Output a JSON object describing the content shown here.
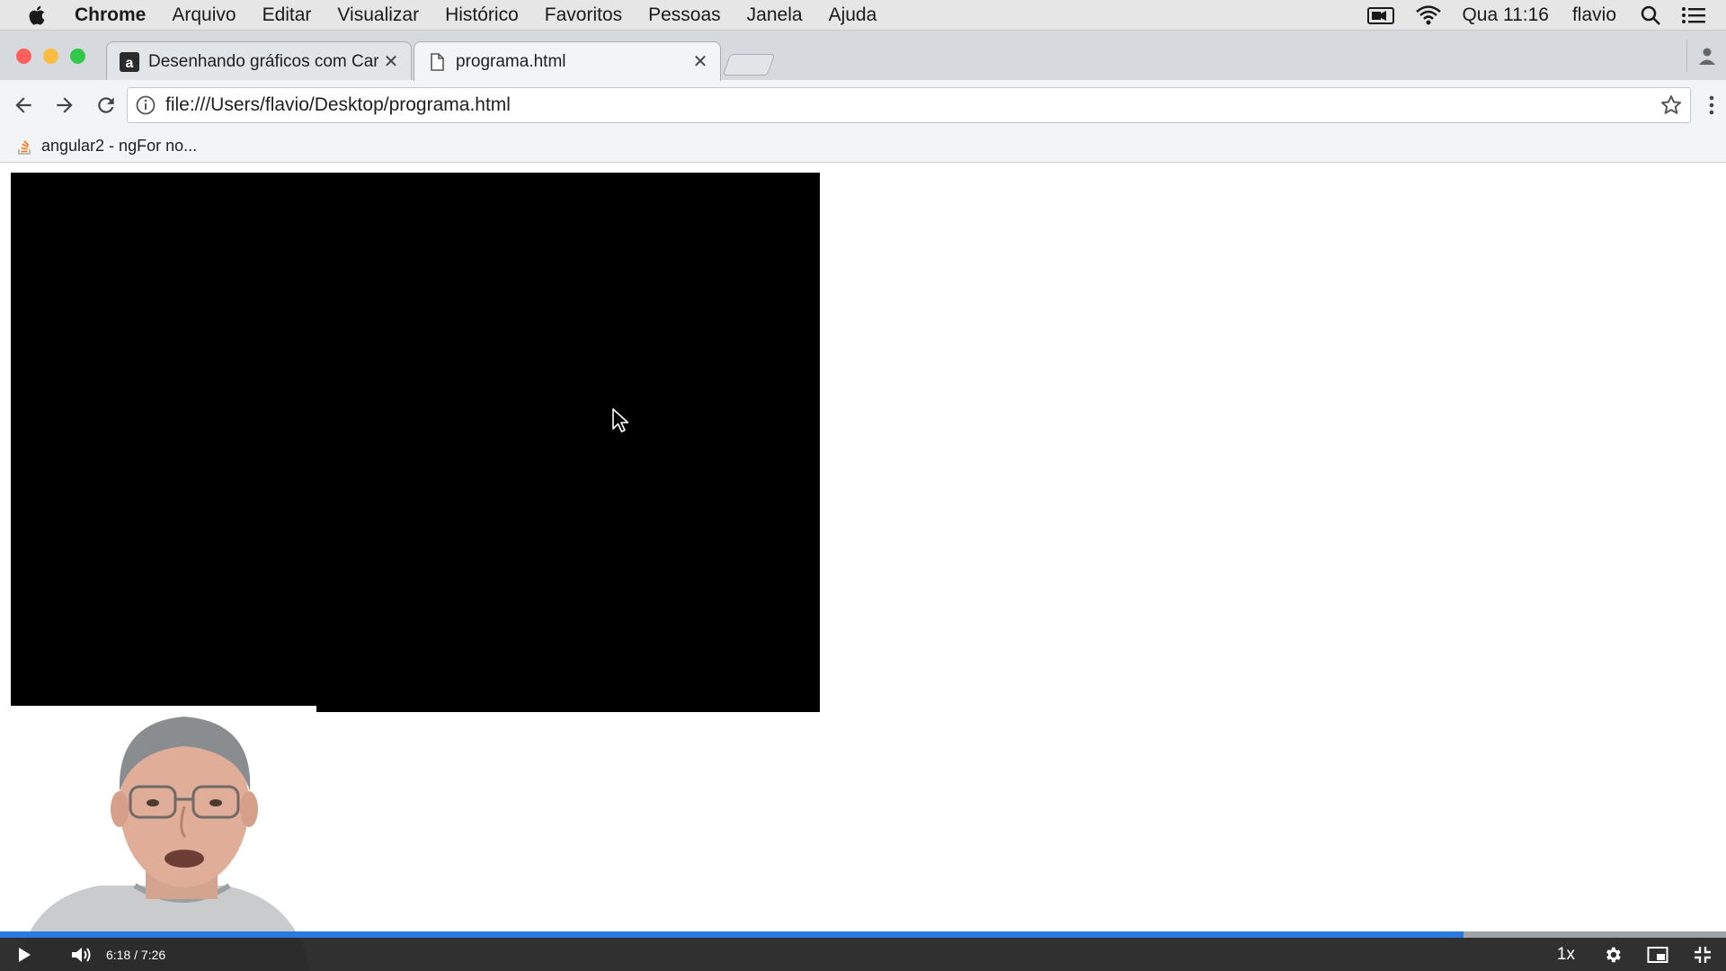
{
  "menubar": {
    "app_name": "Chrome",
    "items": [
      "Arquivo",
      "Editar",
      "Visualizar",
      "Histórico",
      "Favoritos",
      "Pessoas",
      "Janela",
      "Ajuda"
    ],
    "clock": "Qua 11:16",
    "user": "flavio"
  },
  "tabs": [
    {
      "title": "Desenhando gráficos com Car",
      "favicon": "alura-icon",
      "active": false
    },
    {
      "title": "programa.html",
      "favicon": "page-icon",
      "active": true
    }
  ],
  "toolbar": {
    "url": "file:///Users/flavio/Desktop/programa.html"
  },
  "bookmarks": [
    {
      "label": "angular2 - ngFor no..."
    }
  ],
  "player": {
    "current_time": "6:18",
    "separator": "/",
    "duration": "7:26",
    "speed": "1x",
    "progress_fraction": 0.848,
    "accent_color": "#2a7ae2"
  },
  "colors": {
    "canvas": "#000000",
    "close_red": "#fc605c",
    "minimize_yellow": "#fdbc40",
    "zoom_green": "#34c84a"
  }
}
